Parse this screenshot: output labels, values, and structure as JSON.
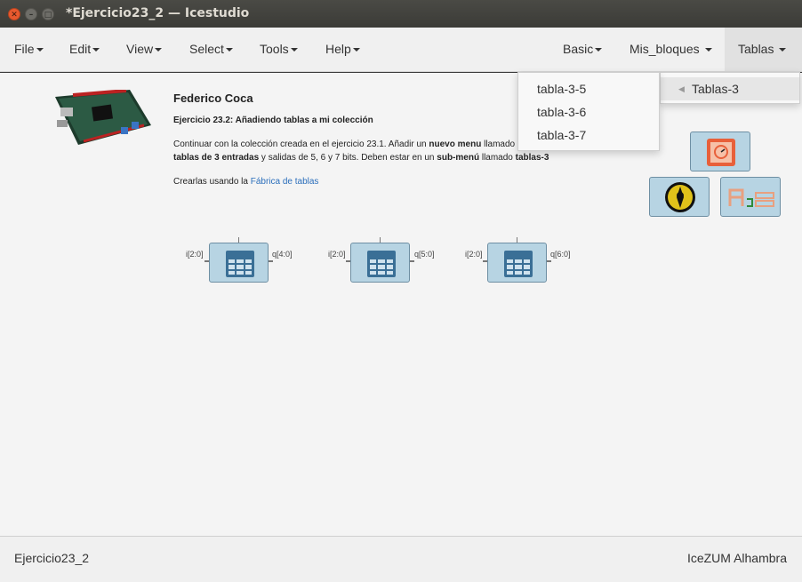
{
  "window": {
    "title": "*Ejercicio23_2 — Icestudio",
    "buttons": [
      "✕",
      "–",
      "□"
    ]
  },
  "menubar": {
    "left": [
      "File",
      "Edit",
      "View",
      "Select",
      "Tools",
      "Help"
    ],
    "right": [
      "Basic",
      "Mis_bloques",
      "Tablas"
    ]
  },
  "tablas_menu": {
    "submenu_label": "Tablas-3",
    "items": [
      "tabla-3-5",
      "tabla-3-6",
      "tabla-3-7"
    ]
  },
  "info": {
    "author": "Federico Coca",
    "subtitle": "Ejercicio 23.2: Añadiendo tablas a mi colección",
    "para1_a": "Continuar con la colección creada en el ejercicio 23.1. Añadir un ",
    "para1_b": "nuevo menu",
    "para1_c": " llamado T",
    "para2_a": "tablas de 3 entradas",
    "para2_b": " y salidas de 5, 6 y 7 bits. Deben estar en un ",
    "para2_c": "sub-menú",
    "para2_d": " llamado ",
    "para2_e": "tablas-3",
    "para3_a": "Crearlas usando la ",
    "para3_link": "Fábrica de tablas"
  },
  "blocks": [
    {
      "in": "i[2:0]",
      "out": "q[4:0]"
    },
    {
      "in": "i[2:0]",
      "out": "q[5:0]"
    },
    {
      "in": "i[2:0]",
      "out": "q[6:0]"
    }
  ],
  "status": {
    "left": "Ejercicio23_2",
    "right": "IceZUM Alhambra"
  },
  "colors": {
    "accent_block": "#b7d4e3",
    "close_button": "#e9592e",
    "link": "#2a6ebb"
  }
}
